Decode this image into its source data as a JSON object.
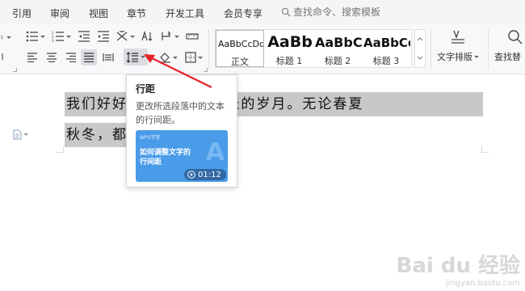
{
  "menu": {
    "items": [
      "引用",
      "审阅",
      "视图",
      "章节",
      "开发工具",
      "会员专享"
    ],
    "search_placeholder": "查找命令、搜索模板"
  },
  "ribbon": {
    "styles": [
      {
        "sample": "AaBbCcDd",
        "name": "正文"
      },
      {
        "sample": "AaBb",
        "name": "标题 1"
      },
      {
        "sample": "AaBbC",
        "name": "标题 2"
      },
      {
        "sample": "AaBbCc",
        "name": "标题 3"
      }
    ],
    "text_layout_label": "文字排版",
    "find_replace_label": "查找替"
  },
  "tooltip": {
    "title": "行距",
    "description": "更改所选段落中的文本的行间距。",
    "video": {
      "tag": "WPS学堂",
      "title": "如何调整文字的行间距",
      "duration": "01:12"
    }
  },
  "document": {
    "line1": "我们好好     能一起走过漫长的岁月。无论春夏",
    "line2": "秋冬，都要在一起。"
  },
  "watermark": {
    "logo": "Bai du 经验",
    "url": "jingyan.baidu.com"
  },
  "colors": {
    "arrow": "#e8242a",
    "selection": "#c8c8c8",
    "video_bg": "#4a9ce8"
  }
}
